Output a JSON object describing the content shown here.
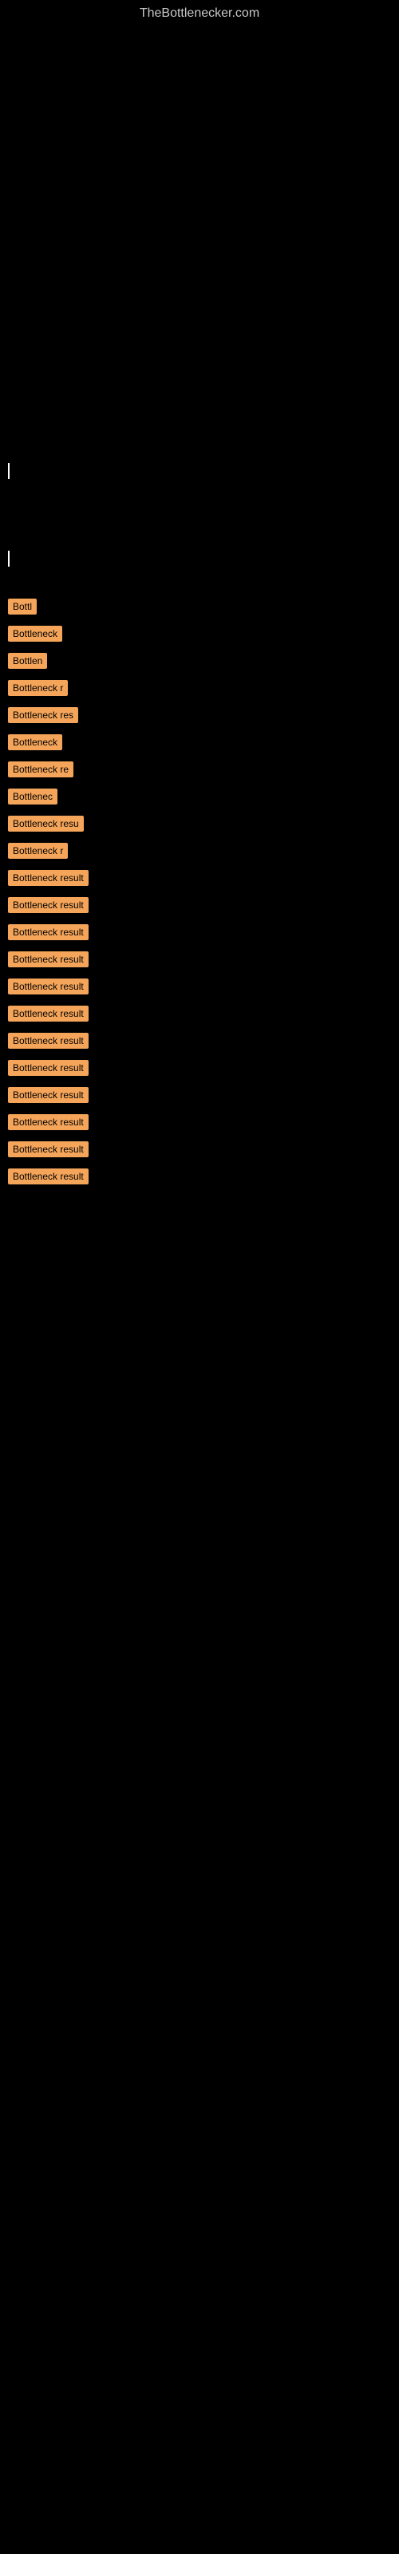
{
  "site": {
    "title": "TheBottlenecker.com"
  },
  "bottleneck_items": [
    {
      "label": "Bottl"
    },
    {
      "label": "Bottleneck"
    },
    {
      "label": "Bottlen"
    },
    {
      "label": "Bottleneck r"
    },
    {
      "label": "Bottleneck res"
    },
    {
      "label": "Bottleneck"
    },
    {
      "label": "Bottleneck re"
    },
    {
      "label": "Bottlenec"
    },
    {
      "label": "Bottleneck resu"
    },
    {
      "label": "Bottleneck r"
    },
    {
      "label": "Bottleneck result"
    },
    {
      "label": "Bottleneck result"
    },
    {
      "label": "Bottleneck result"
    },
    {
      "label": "Bottleneck result"
    },
    {
      "label": "Bottleneck result"
    },
    {
      "label": "Bottleneck result"
    },
    {
      "label": "Bottleneck result"
    },
    {
      "label": "Bottleneck result"
    },
    {
      "label": "Bottleneck result"
    },
    {
      "label": "Bottleneck result"
    },
    {
      "label": "Bottleneck result"
    },
    {
      "label": "Bottleneck result"
    }
  ],
  "accent_color": "#f5a55a"
}
